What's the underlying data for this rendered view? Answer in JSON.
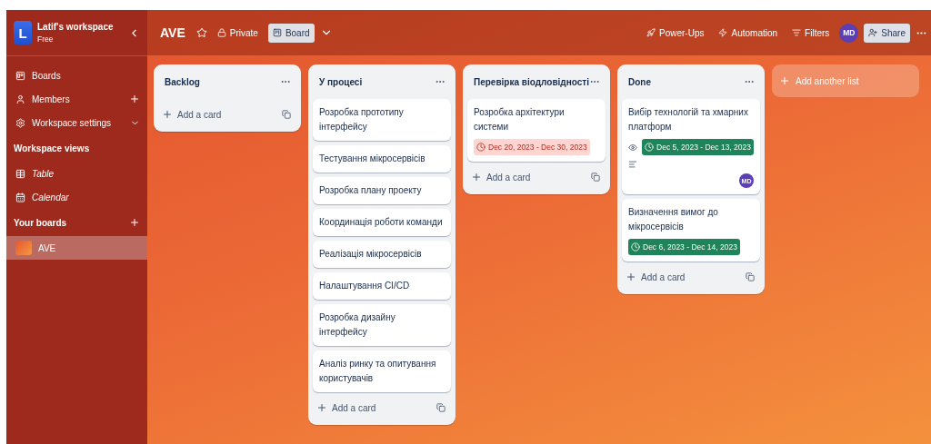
{
  "workspace": {
    "initial": "L",
    "name": "Latif's workspace",
    "plan": "Free"
  },
  "sidebar": {
    "items": [
      {
        "label": "Boards",
        "kind": "plain"
      },
      {
        "label": "Members",
        "kind": "add"
      },
      {
        "label": "Workspace settings",
        "kind": "expand"
      }
    ],
    "views_title": "Workspace views",
    "views": [
      {
        "label": "Table"
      },
      {
        "label": "Calendar"
      }
    ],
    "boards_title": "Your boards",
    "boards": [
      {
        "label": "AVE",
        "selected": true
      }
    ]
  },
  "header": {
    "title": "AVE",
    "starred": false,
    "visibility": "Private",
    "view": "Board",
    "actions": [
      "Power-Ups",
      "Automation",
      "Filters"
    ],
    "member": "MD",
    "share": "Share"
  },
  "lists": [
    {
      "title": "Backlog",
      "add": "Add a card"
    },
    {
      "title": "У процесі",
      "cards": [
        {
          "title": "Розробка прототипу інтерфейсу"
        },
        {
          "title": "Тестування мікросервісів"
        },
        {
          "title": "Розробка плану проекту"
        },
        {
          "title": "Координація роботи команди"
        },
        {
          "title": "Реалізація мікросервісів"
        },
        {
          "title": "Налаштування CI/CD"
        },
        {
          "title": "Розробка дизайну інтерфейсу"
        },
        {
          "title": "Аналіз ринку та опитування користувачів"
        }
      ],
      "add": "Add a card"
    },
    {
      "title": "Перевірка віодловідності",
      "cards": [
        {
          "title": "Розробка архітектури системи",
          "dates": "Dec 20, 2023 - Dec 30, 2023",
          "overdue": true
        }
      ],
      "add": "Add a card"
    },
    {
      "title": "Done",
      "cards": [
        {
          "title": "Вибір технологій та хмарних платформ",
          "watched": true,
          "dates": "Dec 5, 2023 - Dec 13, 2023",
          "overdue": false,
          "has_description": true,
          "member": "MD"
        },
        {
          "title": "Визначення вимог до мікросервісів",
          "dates": "Dec 6, 2023 - Dec 14, 2023",
          "overdue": false
        }
      ],
      "add": "Add a card"
    }
  ],
  "add_list": "Add another list"
}
